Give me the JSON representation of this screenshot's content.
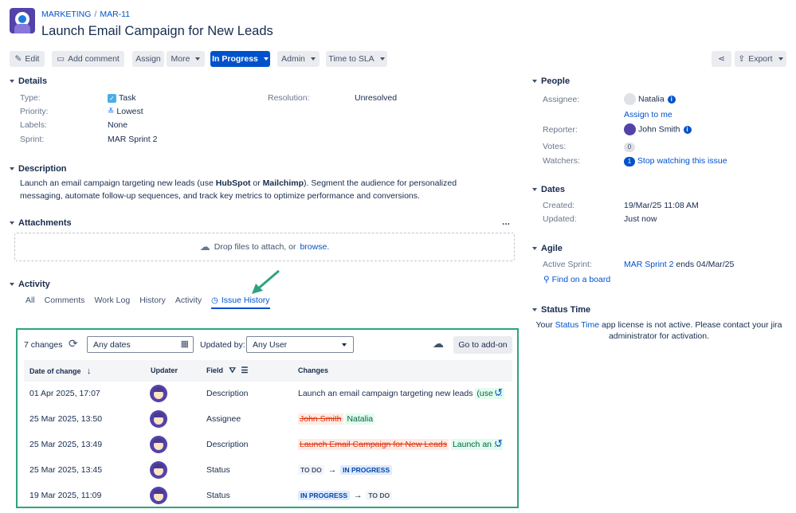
{
  "breadcrumbs": {
    "project": "MARKETING",
    "separator": "/",
    "issue_key": "MAR-11"
  },
  "issue": {
    "title": "Launch Email Campaign for New Leads"
  },
  "toolbar": {
    "edit": "Edit",
    "add_comment": "Add comment",
    "assign": "Assign",
    "more": "More",
    "status": "In Progress",
    "admin": "Admin",
    "time_to_sla": "Time to SLA",
    "export": "Export"
  },
  "details": {
    "header": "Details",
    "type_label": "Type:",
    "type_value": "Task",
    "priority_label": "Priority:",
    "priority_value": "Lowest",
    "labels_label": "Labels:",
    "labels_value": "None",
    "sprint_label": "Sprint:",
    "sprint_value": "MAR Sprint 2",
    "resolution_label": "Resolution:",
    "resolution_value": "Unresolved"
  },
  "description": {
    "header": "Description",
    "part1": "Launch an email campaign targeting new leads (use ",
    "bold1": "HubSpot",
    "part2": " or ",
    "bold2": "Mailchimp",
    "part3": "). Segment the audience for personalized messaging, automate follow-up sequences, and track key metrics to optimize performance and conversions."
  },
  "attachments": {
    "header": "Attachments",
    "more": "...",
    "drop_text": "Drop files to attach, or",
    "browse": "browse."
  },
  "activity": {
    "header": "Activity",
    "tabs": [
      "All",
      "Comments",
      "Work Log",
      "History",
      "Activity"
    ],
    "active_tab": "Issue History"
  },
  "history_panel": {
    "changes_count": "7 changes",
    "dates_value": "Any dates",
    "updated_by_label": "Updated by:",
    "user_value": "Any User",
    "goto_addon": "Go to add-on",
    "columns": {
      "date": "Date of change",
      "updater": "Updater",
      "field": "Field",
      "changes": "Changes"
    },
    "rows": [
      {
        "date": "01 Apr 2025, 17:07",
        "field": "Description",
        "text": "Launch an email campaign targeting new leads",
        "new": "(use ..."
      },
      {
        "date": "25 Mar 2025, 13:50",
        "field": "Assignee",
        "old": "John Smith",
        "new": "Natalia"
      },
      {
        "date": "25 Mar 2025, 13:49",
        "field": "Description",
        "old": "Launch Email Campaign for New Leads",
        "new": "Launch an ..."
      },
      {
        "date": "25 Mar 2025, 13:45",
        "field": "Status",
        "from": "TO DO",
        "to": "IN PROGRESS"
      },
      {
        "date": "19 Mar 2025, 11:09",
        "field": "Status",
        "from": "IN PROGRESS",
        "to": "TO DO"
      }
    ]
  },
  "people": {
    "header": "People",
    "assignee_label": "Assignee:",
    "assignee_value": "Natalia",
    "assign_to_me": "Assign to me",
    "reporter_label": "Reporter:",
    "reporter_value": "John Smith",
    "votes_label": "Votes:",
    "votes_value": "0",
    "watchers_label": "Watchers:",
    "watchers_count": "1",
    "stop_watching": "Stop watching this issue"
  },
  "dates": {
    "header": "Dates",
    "created_label": "Created:",
    "created_value": "19/Mar/25 11:08 AM",
    "updated_label": "Updated:",
    "updated_value": "Just now"
  },
  "agile": {
    "header": "Agile",
    "active_sprint_label": "Active Sprint:",
    "sprint_link": "MAR Sprint 2",
    "sprint_end": "ends 04/Mar/25",
    "find_on_board": "Find on a board"
  },
  "status_time": {
    "header": "Status Time",
    "line1_prefix": "Your",
    "link": "Status Time",
    "line1_suffix": "app license is not active. Please contact your jira",
    "line2": "administrator for activation."
  },
  "colors": {
    "accent": "#0052cc",
    "panel_border": "#2fa37f",
    "arrow": "#2fa37f"
  }
}
